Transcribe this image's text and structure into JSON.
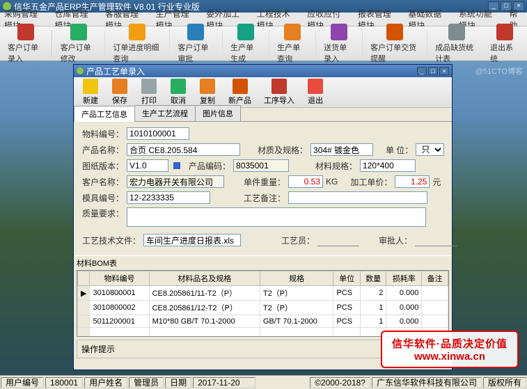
{
  "app_title": "信华五金产品ERP生产管理软件    V8.01 行业专业版",
  "menus": [
    "采购管理模块",
    "仓库管理模块",
    "客服管理模块",
    "生产管理模块",
    "委外加工模块",
    "工程技术模块",
    "应收应付模块",
    "报表管理模块",
    "基础数据模块",
    "系统功能模块",
    "帮助"
  ],
  "main_tb": [
    {
      "label": "客户订单录入",
      "color": "#c0392b"
    },
    {
      "label": "客户订单修改",
      "color": "#27ae60"
    },
    {
      "label": "订单进度明细查询",
      "color": "#f39c12"
    },
    {
      "label": "客户订单审批",
      "color": "#2980b9"
    },
    {
      "label": "生产单生成",
      "color": "#16a085"
    },
    {
      "label": "生产单查询",
      "color": "#e67e22"
    },
    {
      "label": "送货单录入",
      "color": "#8e44ad"
    },
    {
      "label": "客户订单交货提醒",
      "color": "#d35400"
    },
    {
      "label": "成品缺货统计表",
      "color": "#7f8c8d"
    },
    {
      "label": "退出系统",
      "color": "#c0392b"
    }
  ],
  "dialog": {
    "title": "产品工艺单录入",
    "toolbar": [
      {
        "label": "新建",
        "color": "#f1c40f"
      },
      {
        "label": "保存",
        "color": "#e67e22"
      },
      {
        "label": "打印",
        "color": "#95a5a6"
      },
      {
        "label": "取消",
        "color": "#27ae60"
      },
      {
        "label": "复制",
        "color": "#e67e22"
      },
      {
        "label": "新产品",
        "color": "#d35400"
      },
      {
        "label": "工序导入",
        "color": "#c0392b"
      },
      {
        "label": "退出",
        "color": "#e74c3c"
      }
    ],
    "tabs": [
      "产品工艺信息",
      "生产工艺流程",
      "图片信息"
    ],
    "active_tab": 0,
    "form": {
      "material_no_lbl": "物料编号：",
      "material_no": "1010100001",
      "product_name_lbl": "产品名称：",
      "product_name": "合页 CE8.205.584",
      "spec_lbl": "材质及规格：",
      "spec": "304# 镀金色",
      "unit_lbl": "单 位：",
      "unit": "只",
      "unit_options": [
        "只"
      ],
      "drawing_ver_lbl": "图纸版本：",
      "drawing_ver": "V1.0",
      "product_no_lbl": "产品编码：",
      "product_no": "8035001",
      "material_spec_lbl": "材料规格：",
      "material_spec": "120*400",
      "customer_lbl": "客户名称：",
      "customer": "宏力电器开关有限公司",
      "unit_weight_lbl": "单件重量：",
      "unit_weight": "0.53",
      "weight_unit": "KG",
      "proc_price_lbl": "加工单价：",
      "proc_price": "1.25",
      "price_unit": "元",
      "mold_no_lbl": "模具编号：",
      "mold_no": "12-2233335",
      "proc_note_lbl": "工艺备注：",
      "proc_note": "",
      "quality_lbl": "质量要求：",
      "quality": "",
      "tech_file_lbl": "工艺技术文件：",
      "tech_file": "车间生产进度日报表.xls",
      "tech_person_lbl": "工艺员：",
      "tech_person": "",
      "approver_lbl": "审批人：",
      "approver": ""
    },
    "bom_label": "材料BOM表",
    "bom_headers": [
      "物料编号",
      "材料品名及规格",
      "规格",
      "单位",
      "数量",
      "损耗率",
      "备注"
    ],
    "bom_rows": [
      {
        "no": "3010800001",
        "name": "CE8.205861/11-T2（P）",
        "spec": "T2（P）",
        "unit": "PCS",
        "qty": "2",
        "loss": "0.000",
        "note": ""
      },
      {
        "no": "3010800002",
        "name": "CE8.205861/12-T2（P）",
        "spec": "T2（P）",
        "unit": "PCS",
        "qty": "1",
        "loss": "0.000",
        "note": ""
      },
      {
        "no": "5011200001",
        "name": "M10*80 GB/T 70.1-2000",
        "spec": "GB/T 70.1-2000",
        "unit": "PCS",
        "qty": "1",
        "loss": "0.000",
        "note": ""
      }
    ],
    "oper_hint": "操作提示"
  },
  "status": {
    "user_no_lbl": "用户编号",
    "user_no": "180001",
    "user_name_lbl": "用户姓名",
    "user_name": "管理员",
    "date_lbl": "日期",
    "date": "2017-11-20",
    "copyright": "©2000-2018?",
    "company": "广东信华软件科技有限公司",
    "rights": "版权所有"
  },
  "watermark": {
    "l1": "信华软件·品质决定价值",
    "l2": "www.xinwa.cn"
  },
  "blog": "@51CTO博客"
}
